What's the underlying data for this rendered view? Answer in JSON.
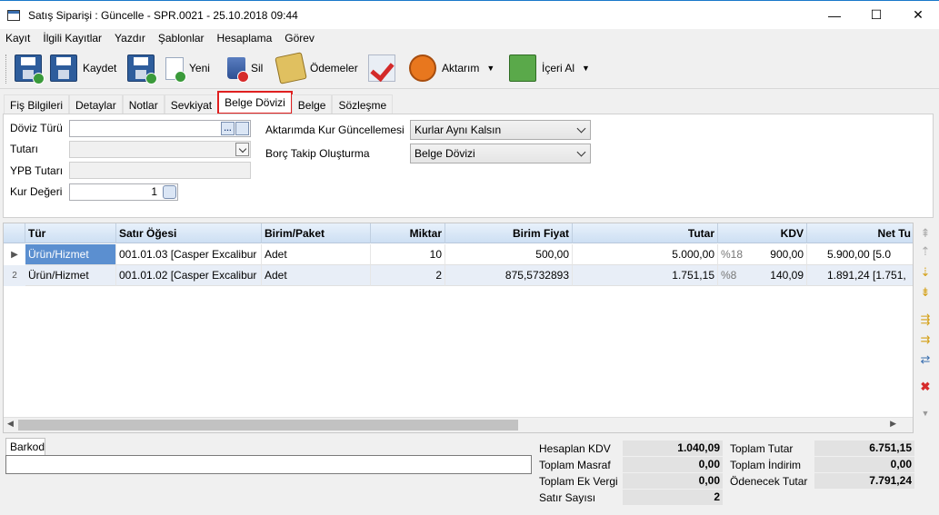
{
  "window": {
    "title": "Satış Siparişi : Güncelle - SPR.0021 - 25.10.2018 09:44",
    "minimize": "—",
    "maximize": "☐",
    "close": "✕"
  },
  "menu": [
    "Kayıt",
    "İlgili Kayıtlar",
    "Yazdır",
    "Şablonlar",
    "Hesaplama",
    "Görev"
  ],
  "toolbar": {
    "save_label": "Kaydet",
    "new_label": "Yeni",
    "delete_label": "Sil",
    "payments_label": "Ödemeler",
    "export_label": "Aktarım",
    "import_label": "İçeri Al",
    "dropdown_arrow": "▼"
  },
  "tabs": [
    "Fiş Bilgileri",
    "Detaylar",
    "Notlar",
    "Sevkiyat",
    "Belge Dövizi",
    "Belge",
    "Sözleşme"
  ],
  "active_tab": "Belge Dövizi",
  "form": {
    "doviz_turu_label": "Döviz Türü",
    "doviz_turu_value": "",
    "tutari_label": "Tutarı",
    "ypb_tutari_label": "YPB Tutarı",
    "kur_degeri_label": "Kur Değeri",
    "kur_degeri_value": "1",
    "aktarimda_label": "Aktarımda Kur Güncellemesi",
    "aktarimda_value": "Kurlar Aynı Kalsın",
    "borc_takip_label": "Borç Takip Oluşturma",
    "borc_takip_value": "Belge Dövizi",
    "ellipsis": "…"
  },
  "grid": {
    "columns": [
      "Tür",
      "Satır Öğesi",
      "Birim/Paket",
      "Miktar",
      "Birim Fiyat",
      "Tutar",
      "KDV",
      "Net Tu"
    ],
    "rows": [
      {
        "indicator": "▶",
        "tur": "Ürün/Hizmet",
        "satir": "001.01.03 [Casper Excalibur",
        "birim": "Adet",
        "miktar": "10",
        "fiyat": "500,00",
        "tutar": "5.000,00",
        "kdv_rate": "%18",
        "kdv": "900,00",
        "net": "5.900,00 [5.0"
      },
      {
        "indicator": "2",
        "tur": "Ürün/Hizmet",
        "satir": "001.01.02 [Casper Excalibur",
        "birim": "Adet",
        "miktar": "2",
        "fiyat": "875,5732893",
        "tutar": "1.751,15",
        "kdv_rate": "%8",
        "kdv": "140,09",
        "net": "1.891,24 [1.751,"
      }
    ]
  },
  "barkod_label": "Barkod",
  "totals": {
    "hesaplan_kdv_label": "Hesaplan KDV",
    "hesaplan_kdv": "1.040,09",
    "toplam_masraf_label": "Toplam Masraf",
    "toplam_masraf": "0,00",
    "toplam_ek_vergi_label": "Toplam Ek Vergi",
    "toplam_ek_vergi": "0,00",
    "satir_sayisi_label": "Satır Sayısı",
    "satir_sayisi": "2",
    "toplam_tutar_label": "Toplam Tutar",
    "toplam_tutar": "6.751,15",
    "toplam_indirim_label": "Toplam İndirim",
    "toplam_indirim": "0,00",
    "odenecek_tutar_label": "Ödenecek Tutar",
    "odenecek_tutar": "7.791,24"
  },
  "colors": {
    "title_accent": "#1979ca",
    "active_tab_outline": "#e02020",
    "grid_header": "#cddff3",
    "focus_cell": "#5b8fd0"
  }
}
